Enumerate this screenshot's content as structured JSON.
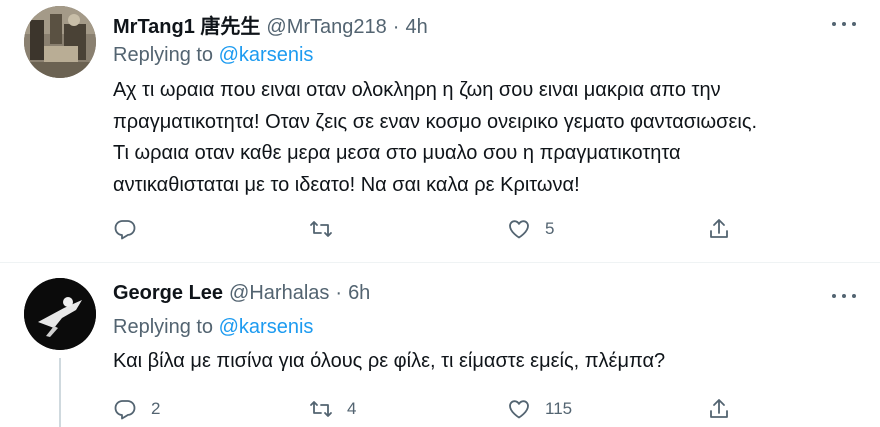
{
  "tweets": [
    {
      "display_name": "MrTang1 唐先生",
      "handle": "@MrTang218",
      "separator": "·",
      "time": "4h",
      "replying_prefix": "Replying to",
      "replying_to": "@karsenis",
      "body_lines": [
        "Αχ τι ωραια που ειναι οταν ολοκληρη η ζωη σου ειναι μακρια απο την",
        "πραγματικοτητα! Οταν ζεις σε εναν κοσμο ονειρικο γεματο φαντασιωσεις.",
        "Τι ωραια οταν καθε μερα μεσα στο μυαλο σου η πραγματικοτητα",
        "αντικαθισταται με το ιδεατο! Να σαι καλα ρε Κριτωνα!"
      ],
      "actions": {
        "reply_icon": "reply-icon",
        "reply_count": "",
        "retweet_icon": "retweet-icon",
        "retweet_count": "",
        "like_icon": "heart-icon",
        "like_count": "5",
        "share_icon": "share-icon"
      }
    },
    {
      "display_name": "George Lee",
      "handle": "@Harhalas",
      "separator": "·",
      "time": "6h",
      "replying_prefix": "Replying to",
      "replying_to": "@karsenis",
      "body_lines": [
        "Και βίλα με πισίνα για όλους ρε φίλε, τι είμαστε εμείς, πλέμπα?"
      ],
      "actions": {
        "reply_icon": "reply-icon",
        "reply_count": "2",
        "retweet_icon": "retweet-icon",
        "retweet_count": "4",
        "like_icon": "heart-icon",
        "like_count": "115",
        "share_icon": "share-icon"
      }
    }
  ],
  "colors": {
    "text_primary": "#0f1419",
    "text_secondary": "#536471",
    "accent": "#1d9bf0",
    "divider": "#eff3f4"
  }
}
